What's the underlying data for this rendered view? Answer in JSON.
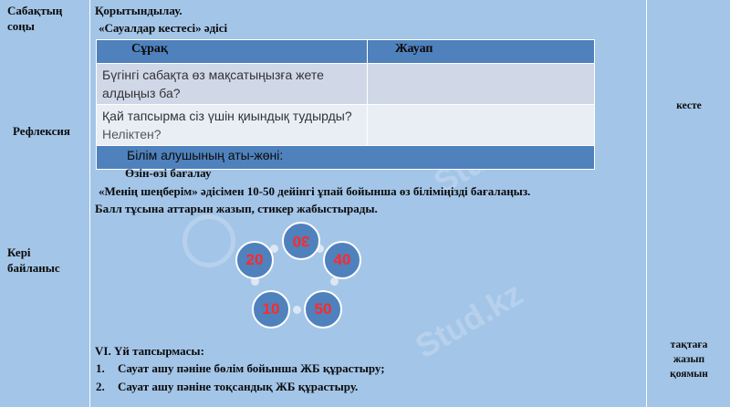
{
  "left_column": {
    "row1": "Сабақтың соңы",
    "row2": "Рефлексия",
    "row3": "Кері байланыс"
  },
  "main": {
    "title": "Қорытындылау.",
    "subtitle": "«Сауалдар кестесі» әдісі",
    "table": {
      "headers": [
        "Сұрақ",
        "Жауап"
      ],
      "rows": [
        {
          "question": "Бүгінгі сабақта өз мақсатыңызға жете алдыңыз ба?",
          "question_tail": "",
          "answer": ""
        },
        {
          "question": " Қай тапсырма сіз үшін қиындық тудырды?",
          "question_tail": " Неліктен?",
          "answer": ""
        }
      ],
      "footer": "Білім алушының аты-жөні:"
    },
    "self_eval_title": "Өзін-өзі бағалау",
    "instruction_line1": "«Менің шеңберім» әдісімен 10-50 дейінгі ұпай  бойынша өз біліміңізді бағалаңыз.",
    "instruction_line2": "Балл тұсына аттарын жазып, стикер жабыстырады.",
    "circles": [
      "20",
      "30",
      "40",
      "10",
      "50"
    ],
    "homework_title": "VI. Үй тапсырмасы:",
    "homework": [
      {
        "num": "1.",
        "text": "Сауат ашу пәніне бөлім бойынша ЖБ құрастыру;"
      },
      {
        "num": "2.",
        "text": "Сауат ашу пәніне тоқсандық ЖБ құрастыру."
      }
    ]
  },
  "right_column": {
    "row2": "кесте",
    "row3": "тақтаға жазып қоямын"
  },
  "colors": {
    "background": "#a3c5e8",
    "table_header": "#4f81bd",
    "row_light": "#d0d8e8",
    "row_lighter": "#e9edf4",
    "circle_text": "#ff2a2a"
  },
  "watermark": "Stud.kz"
}
